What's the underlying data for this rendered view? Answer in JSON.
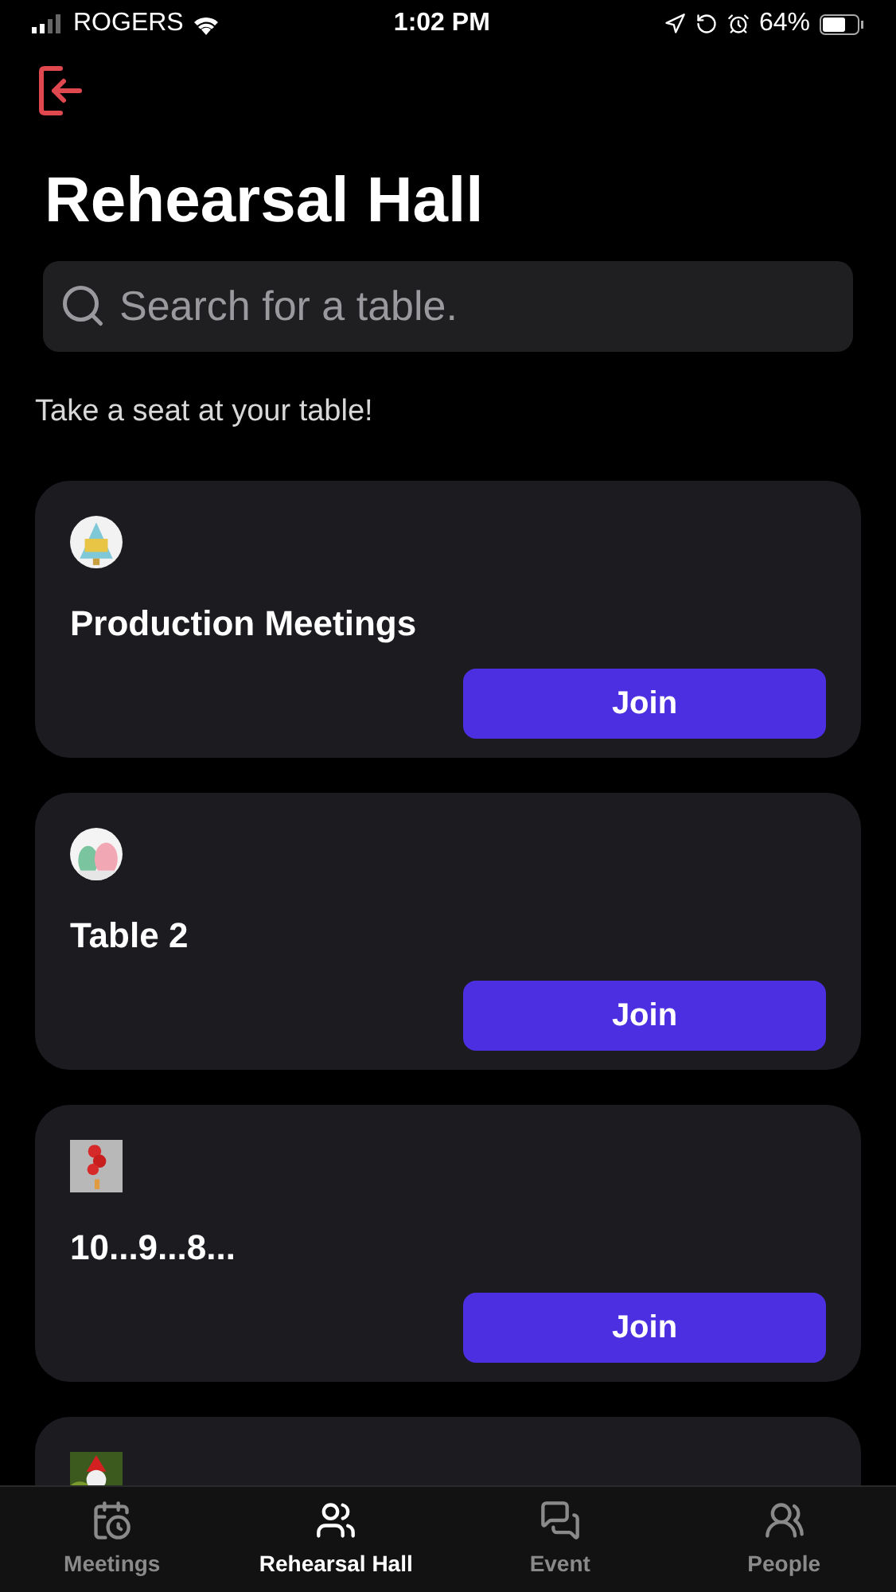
{
  "status_bar": {
    "carrier": "ROGERS",
    "time": "1:02 PM",
    "battery": "64%"
  },
  "title": "Rehearsal Hall",
  "search": {
    "placeholder": "Search for a table."
  },
  "subtitle": "Take a seat at your table!",
  "tables": [
    {
      "title": "Production Meetings",
      "avatar": {
        "kind": "round"
      },
      "button": "Join"
    },
    {
      "title": "Table 2",
      "avatar": {
        "kind": "round"
      },
      "button": "Join"
    },
    {
      "title": "10...9...8...",
      "avatar": {
        "kind": "square"
      },
      "button": "Join"
    },
    {
      "avatar": {
        "kind": "square"
      }
    }
  ],
  "tab_bar": [
    {
      "label": "Meetings",
      "selected": false
    },
    {
      "label": "Rehearsal Hall",
      "selected": true
    },
    {
      "label": "Event",
      "selected": false
    },
    {
      "label": "People",
      "selected": false
    }
  ]
}
